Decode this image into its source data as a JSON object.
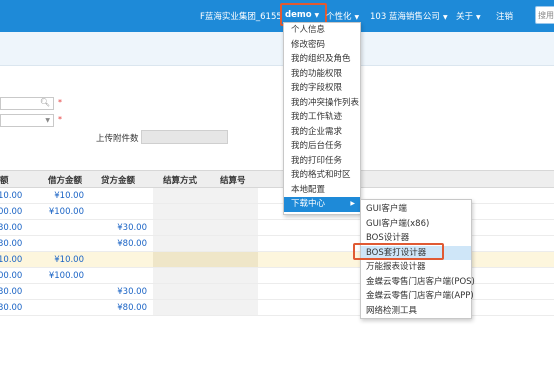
{
  "topbar": {
    "org": "F蓝海实业集团_6155",
    "user": "demo",
    "personalize": "个性化",
    "company": "103  蓝海销售公司",
    "about": "关于",
    "logout": "注销",
    "search_value": "搜用"
  },
  "grid": {
    "headers": [
      "额",
      "借方金额",
      "贷方金额",
      "结算方式",
      "结算号"
    ],
    "rows": [
      {
        "amount": "10.00",
        "debit": "¥10.00",
        "credit": "",
        "highlight": false
      },
      {
        "amount": "00.00",
        "debit": "¥100.00",
        "credit": "",
        "highlight": false
      },
      {
        "amount": "30.00",
        "debit": "",
        "credit": "¥30.00",
        "highlight": false
      },
      {
        "amount": "30.00",
        "debit": "",
        "credit": "¥80.00",
        "highlight": false
      },
      {
        "amount": "10.00",
        "debit": "¥10.00",
        "credit": "",
        "highlight": true
      },
      {
        "amount": "00.00",
        "debit": "¥100.00",
        "credit": "",
        "highlight": false
      },
      {
        "amount": "30.00",
        "debit": "",
        "credit": "¥30.00",
        "highlight": false
      },
      {
        "amount": "30.00",
        "debit": "",
        "credit": "¥80.00",
        "highlight": false
      }
    ]
  },
  "form": {
    "attach_label": "上传附件数",
    "required_mark": "*"
  },
  "menu": {
    "items": [
      {
        "label": "个人信息"
      },
      {
        "label": "修改密码"
      },
      {
        "label": "我的组织及角色"
      },
      {
        "label": "我的功能权限"
      },
      {
        "label": "我的字段权限"
      },
      {
        "label": "我的冲突操作列表"
      },
      {
        "label": "我的工作轨迹"
      },
      {
        "label": "我的企业需求"
      },
      {
        "label": "我的后台任务"
      },
      {
        "label": "我的打印任务"
      },
      {
        "label": "我的格式和时区"
      },
      {
        "label": "本地配置"
      },
      {
        "label": "下载中心",
        "active": true
      }
    ]
  },
  "submenu": {
    "items": [
      {
        "label": "GUI客户端"
      },
      {
        "label": "GUI客户端(x86)"
      },
      {
        "label": "BOS设计器"
      },
      {
        "label": "BOS套打设计器",
        "hover": true
      },
      {
        "label": "万能报表设计器"
      },
      {
        "label": "金蝶云零售门店客户端(POS)"
      },
      {
        "label": "金蝶云零售门店客户端(APP)"
      },
      {
        "label": "网络检测工具"
      }
    ]
  },
  "colors": {
    "accent": "#1e8ad8",
    "highlight_border": "#e05a33",
    "amount_text": "#1b64c5"
  }
}
